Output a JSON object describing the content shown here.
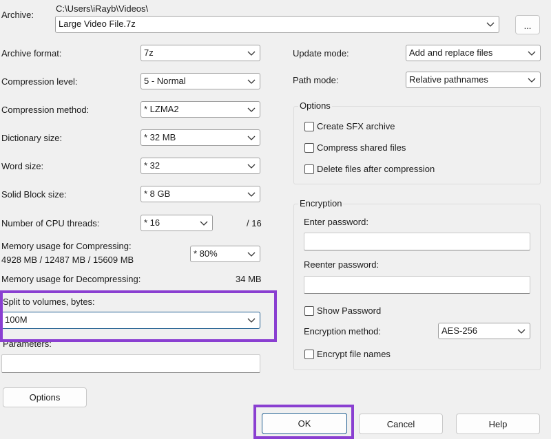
{
  "archive": {
    "label": "Archive:",
    "path": "C:\\Users\\iRayb\\Videos\\",
    "filename": "Large Video File.7z",
    "browse_label": "..."
  },
  "left": {
    "archive_format": {
      "label": "Archive format:",
      "value": "7z"
    },
    "compression_level": {
      "label": "Compression level:",
      "value": "5 - Normal"
    },
    "compression_method": {
      "label": "Compression method:",
      "value": "* LZMA2"
    },
    "dictionary_size": {
      "label": "Dictionary size:",
      "value": "* 32 MB"
    },
    "word_size": {
      "label": "Word size:",
      "value": "* 32"
    },
    "solid_block_size": {
      "label": "Solid Block size:",
      "value": "* 8 GB"
    },
    "cpu_threads": {
      "label": "Number of CPU threads:",
      "value": "* 16",
      "max": "/ 16"
    },
    "memory_compress": {
      "label": "Memory usage for Compressing:",
      "detail": "4928 MB / 12487 MB / 15609 MB",
      "value": "* 80%"
    },
    "memory_decompress": {
      "label": "Memory usage for Decompressing:",
      "value": "34 MB"
    },
    "split_volumes": {
      "label": "Split to volumes, bytes:",
      "value": "100M"
    },
    "parameters": {
      "label": "Parameters:",
      "value": ""
    },
    "options_button": "Options"
  },
  "right": {
    "update_mode": {
      "label": "Update mode:",
      "value": "Add and replace files"
    },
    "path_mode": {
      "label": "Path mode:",
      "value": "Relative pathnames"
    },
    "options_group": {
      "title": "Options",
      "create_sfx": "Create SFX archive",
      "compress_shared": "Compress shared files",
      "delete_after": "Delete files after compression"
    },
    "encryption_group": {
      "title": "Encryption",
      "enter_password": "Enter password:",
      "reenter_password": "Reenter password:",
      "show_password": "Show Password",
      "method_label": "Encryption method:",
      "method_value": "AES-256",
      "encrypt_names": "Encrypt file names"
    }
  },
  "buttons": {
    "ok": "OK",
    "cancel": "Cancel",
    "help": "Help"
  },
  "colors": {
    "highlight": "#8a3fd1",
    "focus_border": "#1f5d8f"
  }
}
